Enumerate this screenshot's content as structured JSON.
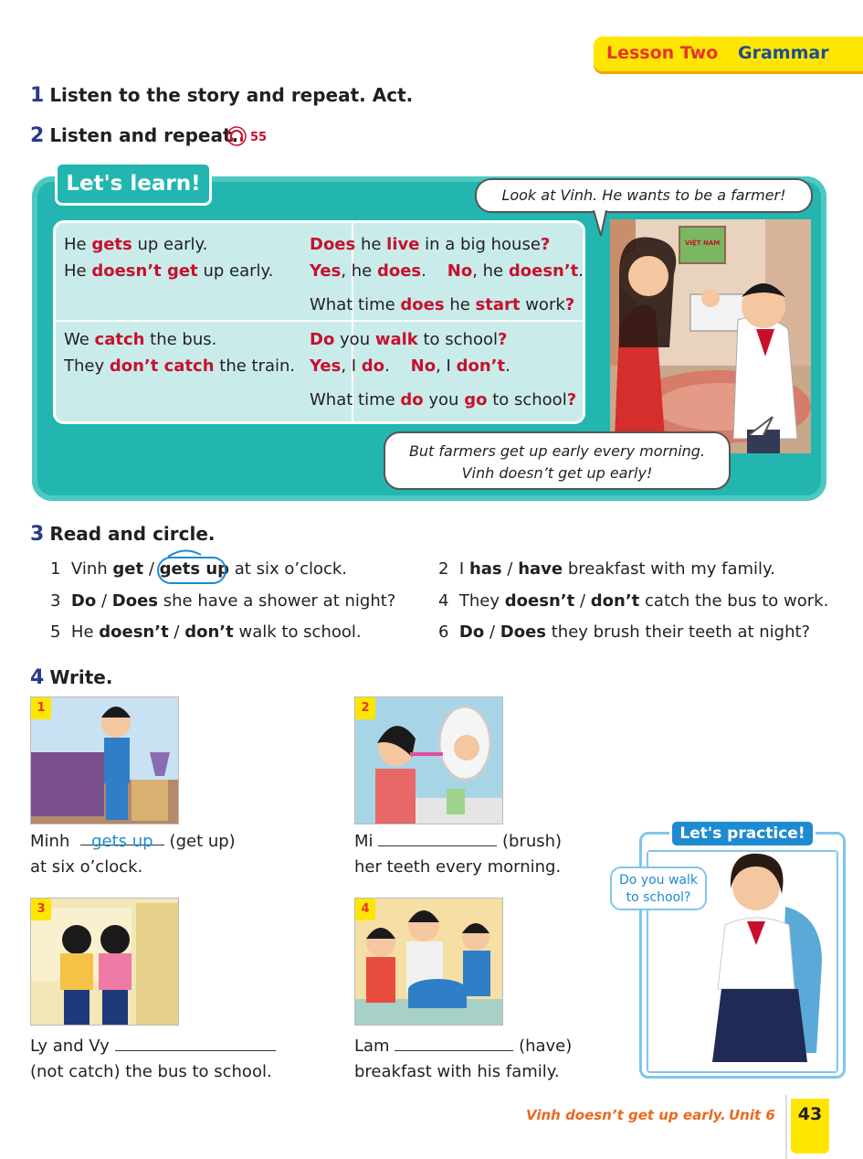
{
  "header": {
    "lesson": "Lesson Two",
    "topic": "Grammar"
  },
  "section1": {
    "number": "1",
    "title": "Listen to the story and repeat. Act."
  },
  "section2": {
    "number": "2",
    "title": "Listen and repeat.",
    "track": "55"
  },
  "lets_learn": {
    "title": "Let's learn!",
    "bubble_top": "Look at Vinh. He wants to be a farmer!",
    "bubble_bottom_1": "But farmers get up early every morning.",
    "bubble_bottom_2": "Vinh doesn’t get up early!",
    "sign_text": "VIỆT NAM"
  },
  "section3": {
    "number": "3",
    "title": "Read and circle.",
    "items": [
      {
        "n": "1",
        "pre": "Vinh",
        "a": "get",
        "sep": "/",
        "b": "gets up",
        "post": "at six o’clock."
      },
      {
        "n": "2",
        "pre": "I",
        "a": "has",
        "sep": "/",
        "b": "have",
        "post": "breakfast with my family."
      },
      {
        "n": "3",
        "pre": "",
        "a": "Do",
        "sep": "/",
        "b": "Does",
        "post": "she have a shower at night?"
      },
      {
        "n": "4",
        "pre": "They",
        "a": "doesn’t",
        "sep": "/",
        "b": "don’t",
        "post": "catch the bus to work."
      },
      {
        "n": "5",
        "pre": "He",
        "a": "doesn’t",
        "sep": "/",
        "b": "don’t",
        "post": "walk to school."
      },
      {
        "n": "6",
        "pre": "",
        "a": "Do",
        "sep": "/",
        "b": "Does",
        "post": "they brush their teeth at night?"
      }
    ]
  },
  "section4": {
    "number": "4",
    "title": "Write.",
    "items": [
      {
        "n": "1",
        "line1_pre": "Minh",
        "answer": "gets up",
        "line1_post": "(get up)",
        "line2": "at six o’clock."
      },
      {
        "n": "2",
        "line1_pre": "Mi",
        "line1_post": "(brush)",
        "line2": "her teeth every morning."
      },
      {
        "n": "3",
        "line1_pre": "Ly and Vy",
        "line2": "(not catch) the bus to school."
      },
      {
        "n": "4",
        "line1_pre": "Lam",
        "line1_post": "(have)",
        "line2": "breakfast with his family."
      }
    ]
  },
  "practice": {
    "title": "Let's practice!",
    "question_1": "Do you walk",
    "question_2": "to school?"
  },
  "footer": {
    "phrase": "Vinh doesn’t get up early.",
    "unit": "Unit 6",
    "page": "43"
  }
}
